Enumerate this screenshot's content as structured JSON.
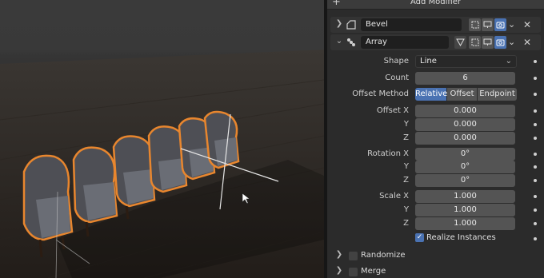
{
  "header": {
    "add_modifier_label": "Add Modifier",
    "plus_icon": "+"
  },
  "modifiers": [
    {
      "name": "Bevel",
      "expanded": false,
      "icon": "bevel-icon"
    },
    {
      "name": "Array",
      "expanded": true,
      "icon": "array-icon"
    }
  ],
  "array": {
    "shape": {
      "label": "Shape",
      "value": "Line"
    },
    "count": {
      "label": "Count",
      "value": "6"
    },
    "offset_method": {
      "label": "Offset Method",
      "options": [
        "Relative",
        "Offset",
        "Endpoint"
      ],
      "selected": "Relative"
    },
    "offset": {
      "label": "Offset X",
      "y_label": "Y",
      "z_label": "Z",
      "x": "0.000",
      "y": "0.000",
      "z": "0.000"
    },
    "rotation": {
      "label": "Rotation X",
      "y_label": "Y",
      "z_label": "Z",
      "x": "0°",
      "y": "0°",
      "z": "0°"
    },
    "scale": {
      "label": "Scale X",
      "y_label": "Y",
      "z_label": "Z",
      "x": "1.000",
      "y": "1.000",
      "z": "1.000"
    },
    "realize_instances": {
      "label": "Realize Instances",
      "checked": true
    }
  },
  "subpanels": [
    {
      "label": "Randomize",
      "enabled": false
    },
    {
      "label": "Merge",
      "enabled": false
    }
  ],
  "colors": {
    "accent": "#4a72b2",
    "selection_outline": "#e8862e",
    "panel_bg": "#2b2b2b"
  }
}
